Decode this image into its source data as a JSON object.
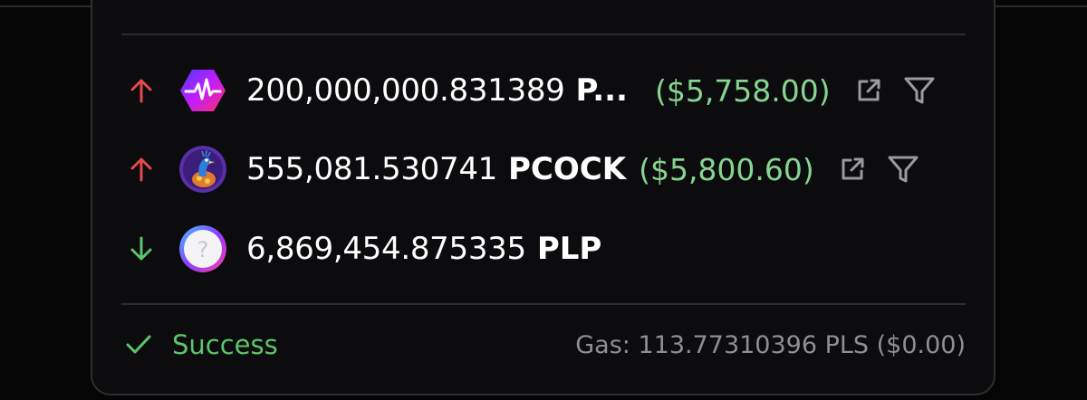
{
  "transfers": [
    {
      "direction": "out",
      "direction_icon": "arrow-up-icon",
      "token_icon": "pulse-logo-icon",
      "amount": "200,000,000.831389",
      "symbol": "P...",
      "usd": "($5,758.00)"
    },
    {
      "direction": "out",
      "direction_icon": "arrow-up-icon",
      "token_icon": "peacock-logo-icon",
      "amount": "555,081.530741",
      "symbol": "PCOCK",
      "usd": "($5,800.60)"
    },
    {
      "direction": "in",
      "direction_icon": "arrow-down-icon",
      "token_icon": "unknown-token-icon",
      "amount": "6,869,454.875335",
      "symbol": "PLP"
    }
  ],
  "status": {
    "icon": "check-icon",
    "label": "Success",
    "gas": "Gas: 113.77310396 PLS ($0.00)"
  },
  "colors": {
    "up_arrow": "#e5484d",
    "down_arrow": "#5cc46a",
    "usd_value": "#86d48f",
    "success": "#5cc46a",
    "muted": "#8e8e93"
  }
}
